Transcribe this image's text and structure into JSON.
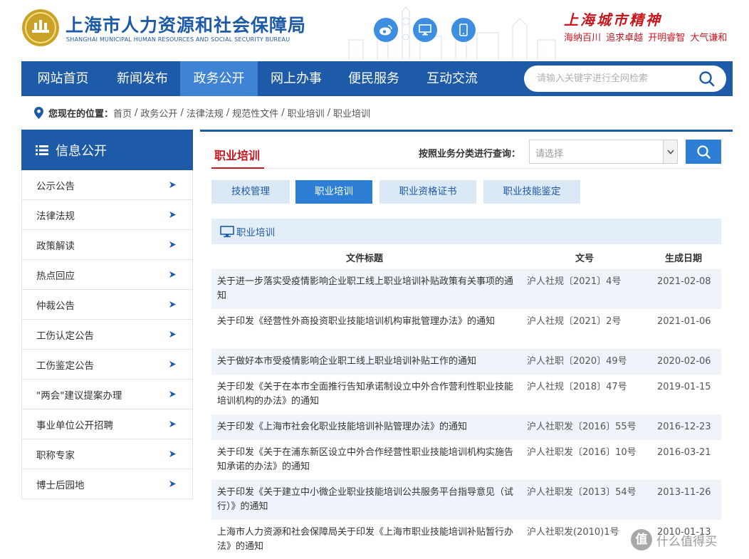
{
  "header": {
    "title_cn": "上海市人力资源和社会保障局",
    "title_en": "SHANGHAI MUNICIPAL HUMAN RESOURCES AND SOCIAL SECURITY BUREAU",
    "slogan_title": "上海城市精神",
    "slogan_sub": "海纳百川 追求卓越 开明睿智 大气谦和",
    "social_icons": [
      "weibo-icon",
      "desktop-icon",
      "mobile-icon"
    ],
    "brand_color": "#1d5aa8",
    "accent_red": "#c8161d"
  },
  "nav": {
    "items": [
      {
        "label": "网站首页",
        "active": false
      },
      {
        "label": "新闻发布",
        "active": false
      },
      {
        "label": "政务公开",
        "active": true
      },
      {
        "label": "网上办事",
        "active": false
      },
      {
        "label": "便民服务",
        "active": false
      },
      {
        "label": "互动交流",
        "active": false
      }
    ],
    "search_placeholder": "请输入关键字进行全网检索"
  },
  "breadcrumb": {
    "label": "您现在的位置：",
    "items": [
      "首页",
      "政务公开",
      "法律法规",
      "规范性文件",
      "职业培训",
      "职业培训"
    ]
  },
  "sidebar": {
    "title": "信息公开",
    "items": [
      {
        "label": "公示公告"
      },
      {
        "label": "法律法规"
      },
      {
        "label": "政策解读"
      },
      {
        "label": "热点回应"
      },
      {
        "label": "仲裁公告"
      },
      {
        "label": "工伤认定公告"
      },
      {
        "label": "工伤鉴定公告"
      },
      {
        "label": "\"两会\"建议提案办理"
      },
      {
        "label": "事业单位公开招聘"
      },
      {
        "label": "职称专家"
      },
      {
        "label": "博士后园地"
      }
    ]
  },
  "main": {
    "title": "职业培训",
    "filter_label": "按照业务分类进行查询：",
    "filter_value": "请选择",
    "tabs": [
      {
        "label": "技校管理",
        "active": false
      },
      {
        "label": "职业培训",
        "active": true
      },
      {
        "label": "职业资格证书",
        "active": false
      },
      {
        "label": "职业技能鉴定",
        "active": false
      }
    ],
    "section_title": "职业培训",
    "columns": [
      "文件标题",
      "文号",
      "生成日期"
    ],
    "rows": [
      {
        "title": "关于进一步落实受疫情影响企业职工线上职业培训补贴政策有关事项的通知",
        "number": "沪人社规〔2021〕4号",
        "date": "2021-02-08"
      },
      {
        "title": "关于印发《经营性外商投资职业技能培训机构审批管理办法》的通知",
        "number": "沪人社规〔2021〕2号",
        "date": "2021-01-06"
      },
      {
        "title": "关于做好本市受疫情影响企业职工线上职业培训补贴工作的通知",
        "number": "沪人社职〔2020〕49号",
        "date": "2020-02-06"
      },
      {
        "title": "关于印发《关于在本市全面推行告知承诺制设立中外合作营利性职业技能培训机构的办法》的通知",
        "number": "沪人社规〔2018〕47号",
        "date": "2019-01-15"
      },
      {
        "title": "关于印发《上海市社会化职业技能培训补贴管理办法》的通知",
        "number": "沪人社职发〔2016〕55号",
        "date": "2016-12-23"
      },
      {
        "title": "关于印发《关于在浦东新区设立中外合作经营性职业技能培训机构实施告知承诺的办法》的通知",
        "number": "沪人社职发〔2016〕10号",
        "date": "2016-03-21"
      },
      {
        "title": "关于印发《关于建立中小微企业职业技能培训公共服务平台指导意见（试行）》的通知",
        "number": "沪人社职发〔2013〕54号",
        "date": "2013-11-26"
      },
      {
        "title": "上海市人力资源和社会保障局关于印发《上海市职业技能培训补贴暂行办法》的通知",
        "number": "沪人社职发(2010)1号",
        "date": "2010-01-13"
      }
    ]
  },
  "watermark": {
    "badge": "值",
    "text": "什么值得买"
  }
}
